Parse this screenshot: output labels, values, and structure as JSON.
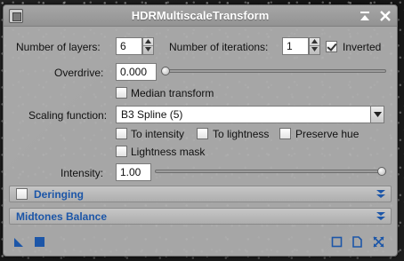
{
  "window": {
    "title": "HDRMultiscaleTransform",
    "icon": "process-icon",
    "shade_icon": "shade-icon",
    "close_icon": "close-icon"
  },
  "params": {
    "num_layers_label": "Number of layers:",
    "num_layers_value": "6",
    "num_iterations_label": "Number of iterations:",
    "num_iterations_value": "1",
    "inverted_label": "Inverted",
    "inverted_checked": true,
    "overdrive_label": "Overdrive:",
    "overdrive_value": "0.000",
    "overdrive_level": 0,
    "median_label": "Median transform",
    "median_checked": false,
    "scaling_label": "Scaling function:",
    "scaling_value": "B3 Spline (5)",
    "to_intensity_label": "To intensity",
    "to_intensity_checked": false,
    "to_lightness_label": "To lightness",
    "to_lightness_checked": false,
    "preserve_hue_label": "Preserve hue",
    "preserve_hue_checked": false,
    "lightness_mask_label": "Lightness mask",
    "lightness_mask_checked": false,
    "intensity_label": "Intensity:",
    "intensity_value": "1.00",
    "intensity_level": 1
  },
  "sections": {
    "deringing_label": "Deringing",
    "deringing_checked": false,
    "midtones_label": "Midtones Balance"
  },
  "footer": {
    "left_icons": [
      "new-instance-icon",
      "apply-global-icon"
    ],
    "right_icons": [
      "preview-icon",
      "edit-instance-icon",
      "reset-icon"
    ]
  },
  "colors": {
    "accent": "#1c56a8",
    "panel": "#b2b2b2",
    "titlebar": "#9a9a9a"
  }
}
